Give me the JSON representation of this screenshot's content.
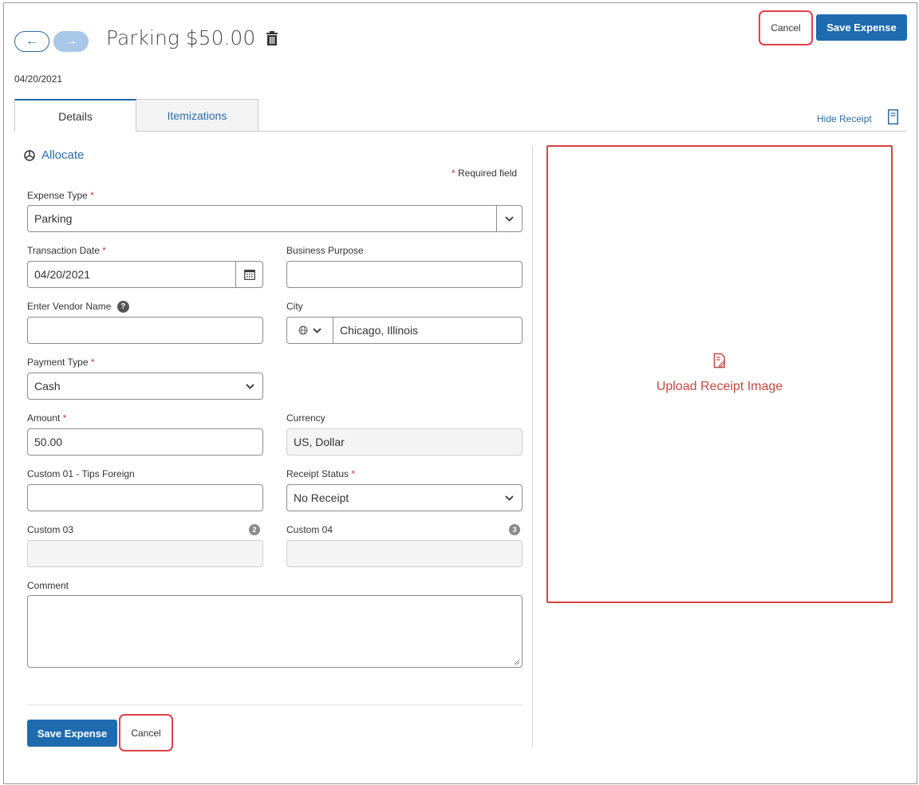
{
  "header": {
    "title": "Parking $50.00",
    "date": "04/20/2021",
    "cancel_label": "Cancel",
    "save_label": "Save Expense"
  },
  "tabs": [
    {
      "label": "Details",
      "active": true
    },
    {
      "label": "Itemizations",
      "active": false
    }
  ],
  "receipt_toggle": "Hide Receipt",
  "form": {
    "allocate_label": "Allocate",
    "required_note": "Required field",
    "required_star": "*",
    "expense_type": {
      "label": "Expense Type",
      "value": "Parking"
    },
    "transaction_date": {
      "label": "Transaction Date",
      "value": "04/20/2021"
    },
    "business_purpose": {
      "label": "Business Purpose",
      "value": ""
    },
    "vendor_name": {
      "label": "Enter Vendor Name",
      "value": "",
      "help": "?"
    },
    "city": {
      "label": "City",
      "value": "Chicago, Illinois"
    },
    "payment_type": {
      "label": "Payment Type",
      "value": "Cash"
    },
    "amount": {
      "label": "Amount",
      "value": "50.00"
    },
    "currency": {
      "label": "Currency",
      "value": "US, Dollar"
    },
    "custom01": {
      "label": "Custom 01 - Tips Foreign",
      "value": ""
    },
    "receipt_status": {
      "label": "Receipt Status",
      "value": "No Receipt"
    },
    "custom03": {
      "label": "Custom 03",
      "badge": "2",
      "value": ""
    },
    "custom04": {
      "label": "Custom 04",
      "badge": "3",
      "value": ""
    },
    "comment": {
      "label": "Comment",
      "value": ""
    }
  },
  "footer": {
    "save_label": "Save Expense",
    "cancel_label": "Cancel"
  },
  "receipt_panel": {
    "upload_label": "Upload Receipt Image"
  },
  "colors": {
    "primary": "#1f6bb0",
    "link": "#2a6ca8",
    "required": "#c0392b",
    "highlight": "#e0404a"
  },
  "icons": [
    "back-arrow-icon",
    "forward-arrow-icon",
    "trash-icon",
    "receipt-icon",
    "allocate-pie-icon",
    "chevron-down-icon",
    "calendar-icon",
    "globe-icon",
    "help-icon",
    "upload-receipt-icon"
  ]
}
